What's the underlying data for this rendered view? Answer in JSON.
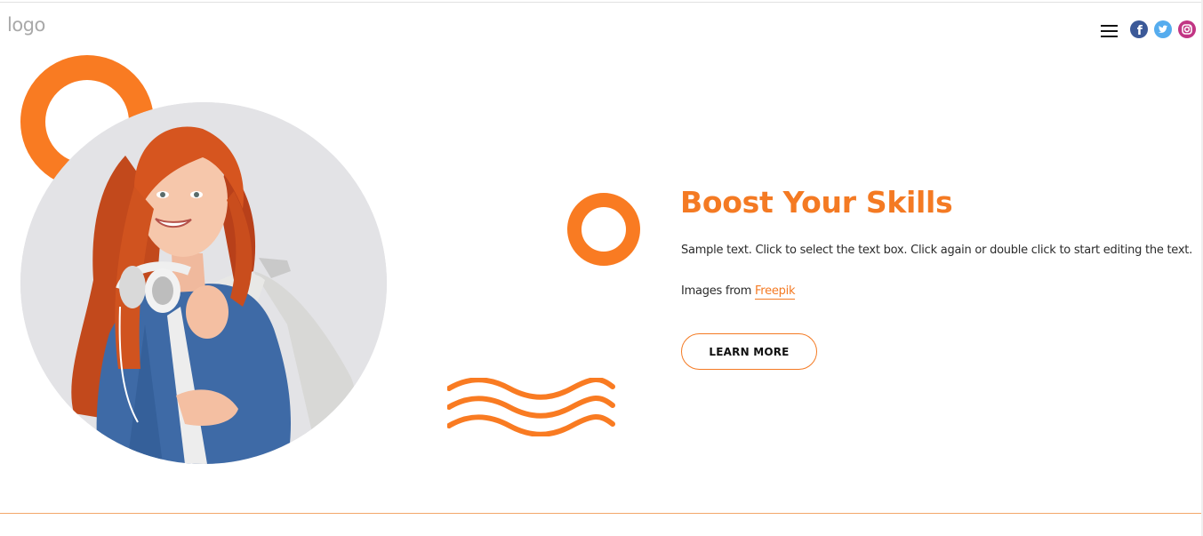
{
  "header": {
    "logo_text": "logo",
    "menu_icon": "hamburger-menu-icon",
    "social": [
      {
        "name": "facebook",
        "icon": "facebook-icon",
        "glyph": "f",
        "color": "#3b5998"
      },
      {
        "name": "twitter",
        "icon": "twitter-icon",
        "color": "#55acee"
      },
      {
        "name": "instagram",
        "icon": "instagram-icon",
        "color": "#c13584"
      }
    ]
  },
  "hero": {
    "headline": "Boost Your Skills",
    "body": "Sample text. Click to select the text box. Click again or double click to start editing the text.",
    "credit_prefix": "Images from ",
    "credit_link": "Freepik",
    "button_label": "LEARN MORE"
  },
  "colors": {
    "accent": "#f47a23",
    "photo_background": "#e3e3e6",
    "logo_gray": "#a9a9a9"
  }
}
